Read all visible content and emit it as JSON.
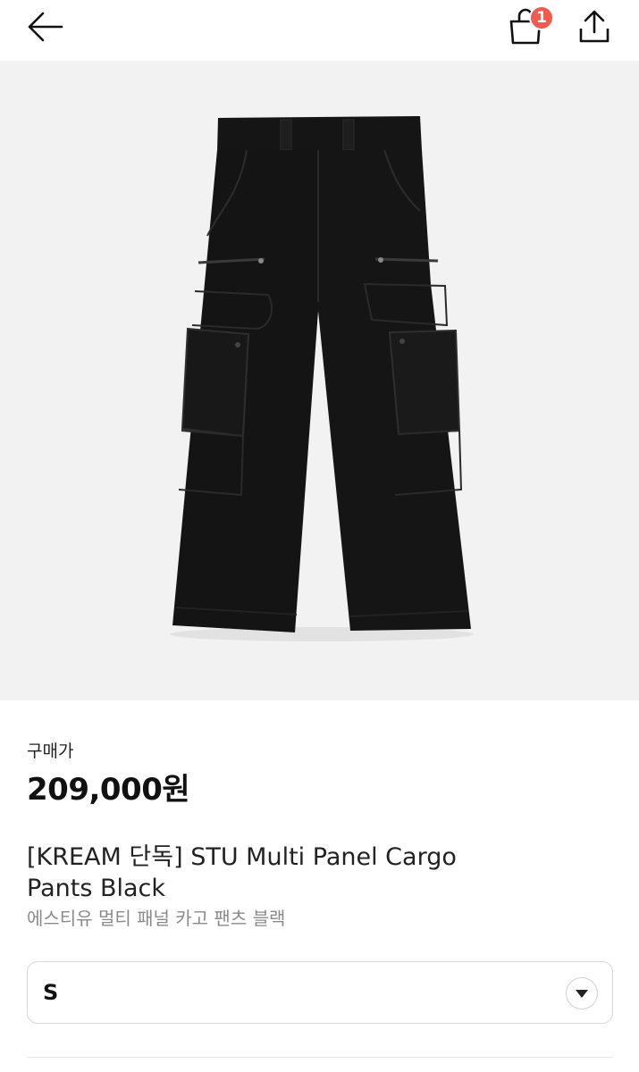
{
  "header": {
    "back_icon": "arrow-left-icon",
    "cart_icon": "shopping-bag-icon",
    "cart_count": "1",
    "share_icon": "share-upload-icon"
  },
  "product": {
    "image_icon": "cargo-pants-image",
    "price_label": "구매가",
    "price": "209,000원",
    "title": "[KREAM 단독] STU Multi Panel Cargo Pants Black",
    "subtitle": "에스티유 멀티 패널 카고 팬츠 블랙"
  },
  "size_select": {
    "value": "S",
    "chevron_icon": "chevron-down-icon"
  },
  "colors": {
    "badge": "#ef5b50",
    "image_bg": "#f2f2f2",
    "subtitle": "#8a8a8a"
  }
}
